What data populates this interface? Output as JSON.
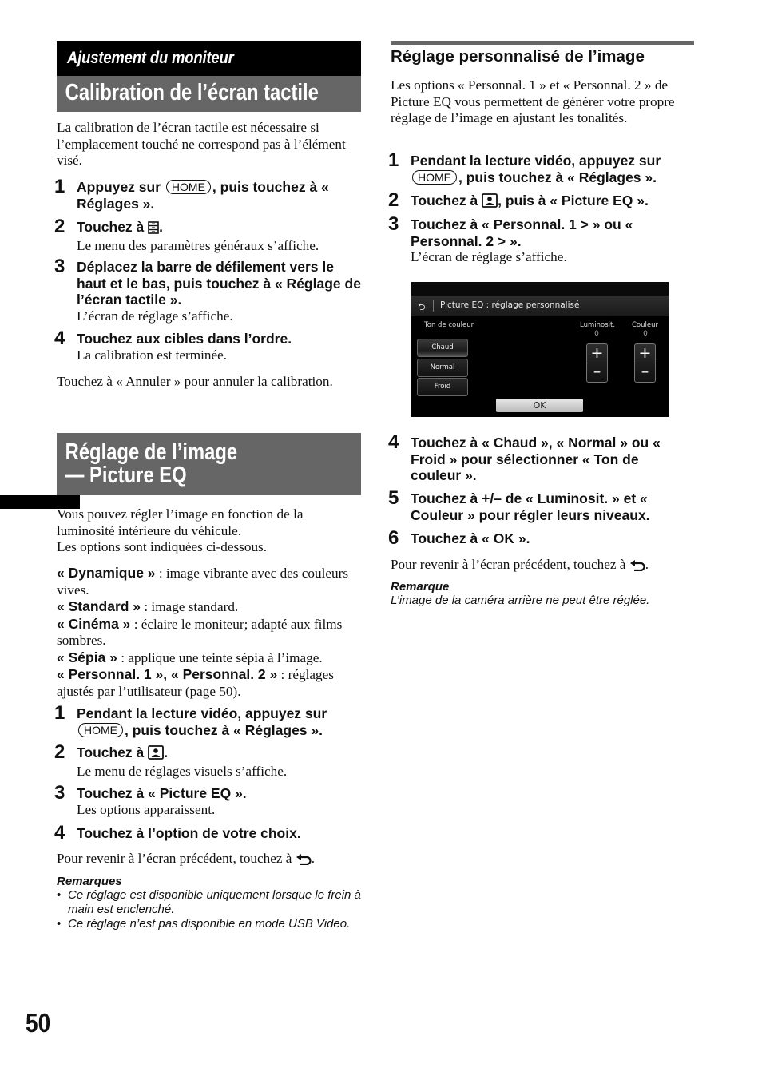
{
  "page_number": "50",
  "left_column": {
    "section_banner": "Ajustement du moniteur",
    "calibration": {
      "heading": "Calibration de l’écran tactile",
      "intro": "La calibration de l’écran tactile est nécessaire si l’emplacement touché ne correspond pas à l’élément visé.",
      "steps": [
        {
          "num": "1",
          "pre": "Appuyez sur",
          "key": "HOME",
          "post": ", puis touchez à « Réglages ».",
          "sub": ""
        },
        {
          "num": "2",
          "pre": "Touchez à",
          "icon": "settings-general-icon",
          "post": ".",
          "sub": "Le menu des paramètres généraux s’affiche."
        },
        {
          "num": "3",
          "text": "Déplacez la barre de défilement vers le haut et le bas, puis touchez à « Réglage de l’écran tactile ».",
          "sub": "L’écran de réglage s’affiche."
        },
        {
          "num": "4",
          "text": "Touchez aux cibles dans l’ordre.",
          "sub": "La calibration est terminée."
        }
      ],
      "footer": "Touchez à « Annuler » pour annuler la calibration."
    },
    "picture_eq": {
      "heading_line1": "Réglage de l’image",
      "heading_line2": "— Picture EQ",
      "intro_line1": "Vous pouvez régler l’image en fonction de la luminosité intérieure du véhicule.",
      "intro_line2": "Les options sont indiquées ci-dessous.",
      "options": [
        {
          "name": "« Dynamique »",
          "desc": " : image vibrante avec des couleurs vives."
        },
        {
          "name": "« Standard »",
          "desc": " : image standard."
        },
        {
          "name": "« Cinéma »",
          "desc": " : éclaire le moniteur; adapté aux films sombres."
        },
        {
          "name": "« Sépia »",
          "desc": " : applique une teinte sépia à l’image."
        },
        {
          "name": "« Personnal. 1 », « Personnal. 2 »",
          "desc": " : réglages ajustés par l’utilisateur (page 50)."
        }
      ],
      "steps": [
        {
          "num": "1",
          "pre": "Pendant la lecture vidéo, appuyez sur",
          "key": "HOME",
          "post": ", puis touchez à « Réglages ».",
          "sub": ""
        },
        {
          "num": "2",
          "pre": "Touchez à",
          "icon": "picture-settings-icon",
          "post": ".",
          "sub": "Le menu de réglages visuels s’affiche."
        },
        {
          "num": "3",
          "text": "Touchez à « Picture EQ ».",
          "sub": "Les options apparaissent."
        },
        {
          "num": "4",
          "text": "Touchez à l’option de votre choix.",
          "sub": ""
        }
      ],
      "back_text": "Pour revenir à l’écran précédent, touchez à",
      "notes_heading": "Remarques",
      "notes": [
        "Ce réglage est disponible uniquement lorsque le frein à main est enclenché.",
        "Ce réglage n’est pas disponible en mode USB Video."
      ]
    }
  },
  "right_column": {
    "heading": "Réglage personnalisé de l’image",
    "intro": "Les options « Personnal. 1 » et « Personnal. 2 » de Picture EQ vous permettent de générer votre propre réglage de l’image en ajustant les tonalités.",
    "steps_a": [
      {
        "num": "1",
        "pre": "Pendant la lecture vidéo, appuyez sur",
        "key": "HOME",
        "post": ", puis touchez à « Réglages »."
      },
      {
        "num": "2",
        "pre": "Touchez à",
        "icon": "picture-settings-icon",
        "post": ", puis à « Picture EQ »."
      },
      {
        "num": "3",
        "text": "Touchez à « Personnal. 1 > » ou « Personnal. 2 > ».",
        "sub": "L’écran de réglage s’affiche."
      }
    ],
    "screen": {
      "title": "Picture EQ : réglage personnalisé",
      "tone_label": "Ton de couleur",
      "tone_buttons": [
        "Chaud",
        "Normal",
        "Froid"
      ],
      "selected_tone": "Chaud",
      "brightness_label": "Luminosit.",
      "brightness_value": "0",
      "color_label": "Couleur",
      "color_value": "0",
      "plus": "+",
      "minus": "–",
      "ok_label": "OK"
    },
    "steps_b": [
      {
        "num": "4",
        "text": "Touchez à « Chaud », « Normal » ou « Froid » pour sélectionner « Ton de couleur »."
      },
      {
        "num": "5",
        "text": "Touchez à +/– de « Luminosit. » et « Couleur » pour régler leurs niveaux."
      },
      {
        "num": "6",
        "text": "Touchez à « OK »."
      }
    ],
    "back_text": "Pour revenir à l’écran précédent, touchez à",
    "note_heading": "Remarque",
    "note": "L’image de la caméra arrière ne peut être réglée."
  }
}
